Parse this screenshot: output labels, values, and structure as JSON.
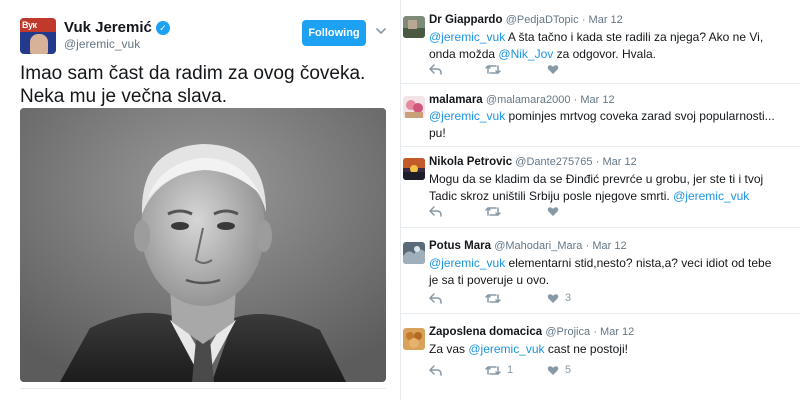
{
  "main_tweet": {
    "author_name": "Vuk Jeremić",
    "author_handle": "@jeremic_vuk",
    "avatar_text": "Вук",
    "follow_label": "Following",
    "text": "Imao sam čast da radim za ovog čoveka. Neka mu je večna slava."
  },
  "replies": [
    {
      "name": "Dr Giappardo",
      "handle": "@PedjaDTopic",
      "date": "· Mar 12",
      "parts": [
        {
          "t": "@jeremic_vuk",
          "m": true
        },
        {
          "t": " A šta tačno i kada ste radili za njega? Ako ne Vi, onda možda ",
          "m": false
        },
        {
          "t": "@Nik_Jov",
          "m": true
        },
        {
          "t": " za odgovor. Hvala.",
          "m": false
        }
      ],
      "retweets": "",
      "likes": ""
    },
    {
      "name": "malamara",
      "handle": "@malamara2000",
      "date": "· Mar 12",
      "parts": [
        {
          "t": "@jeremic_vuk",
          "m": true
        },
        {
          "t": " pominjes mrtvog coveka zarad svoj popularnosti... pu!",
          "m": false
        }
      ],
      "retweets": "",
      "likes": ""
    },
    {
      "name": "Nikola Petrovic",
      "handle": "@Dante275765",
      "date": "· Mar 12",
      "parts": [
        {
          "t": "Mogu da se kladim da se Đinđić prevrće u grobu, jer ste ti i tvoj Tadic skroz uništili Srbiju posle njegove smrti. ",
          "m": false
        },
        {
          "t": "@jeremic_vuk",
          "m": true
        }
      ],
      "retweets": "",
      "likes": ""
    },
    {
      "name": "Potus Mara",
      "handle": "@Mahodari_Mara",
      "date": "· Mar 12",
      "parts": [
        {
          "t": "@jeremic_vuk",
          "m": true
        },
        {
          "t": " elementarni stid,nesto? nista,a? veci idiot od tebe je sa ti poveruje u ovo.",
          "m": false
        }
      ],
      "retweets": "",
      "likes": "3"
    },
    {
      "name": "Zaposlena domacica",
      "handle": "@Projica",
      "date": "· Mar 12",
      "parts": [
        {
          "t": "Za vas ",
          "m": false
        },
        {
          "t": "@jeremic_vuk",
          "m": true
        },
        {
          "t": " cast ne postoji!",
          "m": false
        }
      ],
      "retweets": "1",
      "likes": "5"
    }
  ],
  "colors": {
    "accent": "#1da1f2",
    "mention": "#1b95e0",
    "muted": "#657786",
    "icon": "#8899a6"
  },
  "icons": [
    "verified-badge-icon",
    "chevron-down-icon",
    "reply-icon",
    "retweet-icon",
    "like-icon"
  ]
}
